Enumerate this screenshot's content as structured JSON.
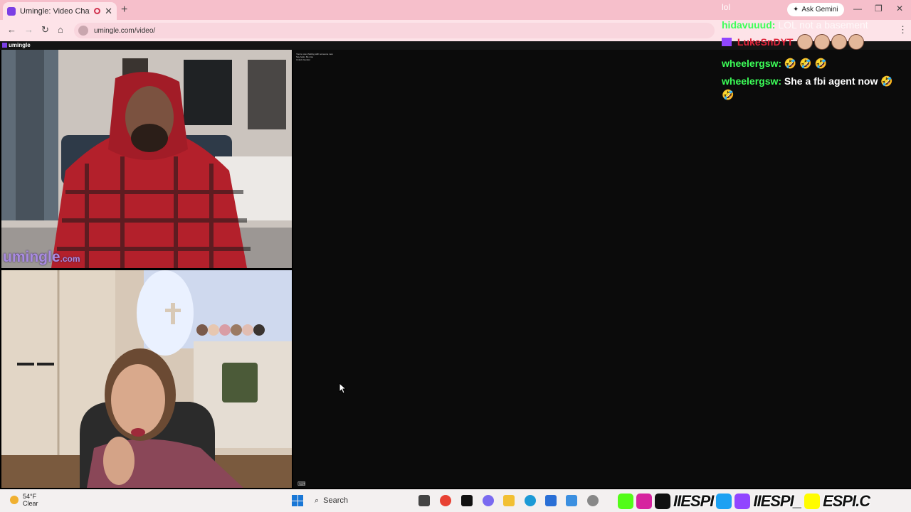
{
  "browser": {
    "tab_title": "Umingle: Video Chat with S",
    "new_tab": "+",
    "ask_gemini": "Ask Gemini",
    "url": "umingle.com/video/"
  },
  "site": {
    "header_logo": "umingle",
    "brand_main": "umingle",
    "brand_suffix": ".com",
    "notice_line1": "You're now chatting with someone new",
    "notice_line2": "Say hello. Be nice",
    "notice_line3": "Unlock Gender"
  },
  "stream_chat": [
    {
      "user": "",
      "message": "lol"
    },
    {
      "user": "hidavuuud:",
      "message": "LOL not a basement"
    },
    {
      "user": "LukeSnDYT",
      "message": ""
    },
    {
      "user": "wheelergsw:",
      "message": "🤣 🤣 🤣"
    },
    {
      "user": "wheelergsw:",
      "message": "She a fbi agent now 🤣"
    },
    {
      "user": "",
      "message": "🤣"
    }
  ],
  "taskbar": {
    "temperature": "54°F",
    "condition": "Clear",
    "search_label": "Search"
  },
  "socials": {
    "handle1": "IIESPI",
    "handle2": "IIESPI_",
    "handle3": "ESPI.C"
  },
  "colors": {
    "tabbar": "#f6bfcb",
    "brand": "#a98be0",
    "chat_user": "#3cff58",
    "chat_red_user": "#e0243a"
  }
}
